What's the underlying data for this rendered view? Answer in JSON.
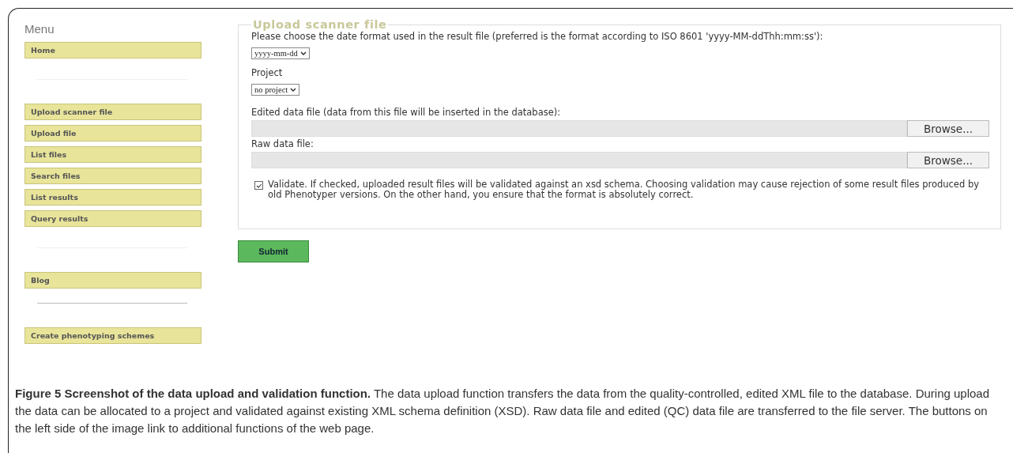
{
  "sidebar": {
    "title": "Menu",
    "items": [
      {
        "kind": "button",
        "label": "Home"
      },
      {
        "kind": "separator"
      },
      {
        "kind": "button",
        "label": "Upload scanner file"
      },
      {
        "kind": "button",
        "label": "Upload file"
      },
      {
        "kind": "button",
        "label": "List files"
      },
      {
        "kind": "button",
        "label": "Search files"
      },
      {
        "kind": "button",
        "label": "List results"
      },
      {
        "kind": "button",
        "label": "Query results"
      },
      {
        "kind": "separator"
      },
      {
        "kind": "button",
        "label": "Blog"
      },
      {
        "kind": "separator"
      },
      {
        "kind": "button",
        "label": "Create phenotyping schemes"
      }
    ]
  },
  "form": {
    "legend": "Upload scanner file",
    "date_format": {
      "label": "Please choose the date format used in the result file (preferred is the format according to ISO 8601 'yyyy-MM-ddThh:mm:ss'):",
      "value": "yyyy-mm-dd"
    },
    "project": {
      "label": "Project",
      "value": "no project"
    },
    "files": [
      {
        "label": "Edited data file (data from this file will be inserted in the database):",
        "button": "Browse..."
      },
      {
        "label": "Raw data file:",
        "button": "Browse..."
      }
    ],
    "validate": {
      "checked": true,
      "text": "Validate. If checked, uploaded result files will be validated against an xsd schema. Choosing validation may cause rejection of some result files produced by old Phenotyper versions. On the other hand, you ensure that the format is absolutely correct."
    },
    "submit": "Submit"
  },
  "caption": "**Figure 5 Screenshot of the data upload and validation function.** The data upload function transfers the data from the quality-controlled, edited XML file to the database. During upload the data can be allocated to a project and validated against existing XML schema definition (XSD). Raw data file and edited (QC) data file are transferred to the file server. The buttons on the left side of the image link to additional functions of the web page."
}
